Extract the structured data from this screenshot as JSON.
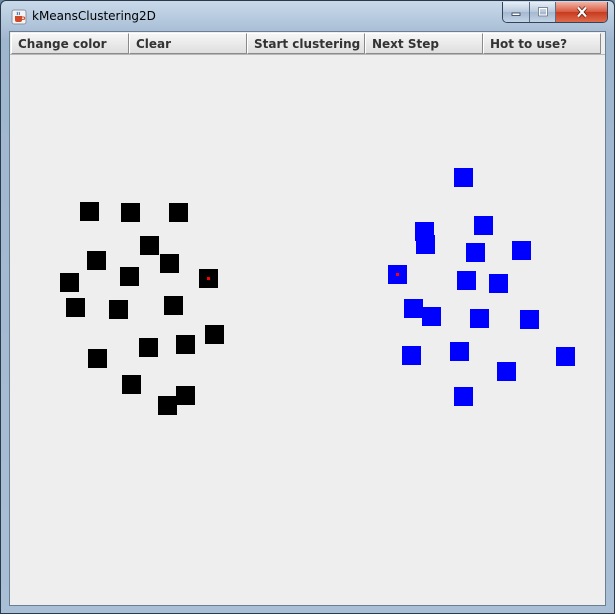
{
  "window": {
    "title": "kMeansClustering2D",
    "app_icon": "java-cup-icon",
    "controls": [
      "minimize-icon",
      "maximize-icon",
      "close-icon"
    ]
  },
  "toolbar": {
    "buttons": [
      {
        "label": "Change color"
      },
      {
        "label": "Clear"
      },
      {
        "label": "Start clustering"
      },
      {
        "label": "Next Step"
      },
      {
        "label": "Hot to use?"
      }
    ]
  },
  "canvas": {
    "background": "#eeeeee",
    "clusters": [
      {
        "color": "#000000",
        "points": [
          [
            79,
            201
          ],
          [
            120,
            202
          ],
          [
            168,
            202
          ],
          [
            139,
            235
          ],
          [
            86,
            250
          ],
          [
            159,
            253
          ],
          [
            59,
            272
          ],
          [
            119,
            266
          ],
          [
            198,
            268
          ],
          [
            65,
            297
          ],
          [
            108,
            299
          ],
          [
            163,
            295
          ],
          [
            204,
            324
          ],
          [
            138,
            337
          ],
          [
            175,
            334
          ],
          [
            87,
            348
          ],
          [
            121,
            374
          ],
          [
            175,
            385
          ],
          [
            157,
            395
          ]
        ],
        "centroid_index": 8
      },
      {
        "color": "#0000ff",
        "points": [
          [
            453,
            167
          ],
          [
            473,
            215
          ],
          [
            414,
            221
          ],
          [
            415,
            234
          ],
          [
            465,
            242
          ],
          [
            511,
            240
          ],
          [
            387,
            264
          ],
          [
            456,
            270
          ],
          [
            488,
            273
          ],
          [
            403,
            298
          ],
          [
            421,
            306
          ],
          [
            469,
            308
          ],
          [
            519,
            309
          ],
          [
            449,
            341
          ],
          [
            401,
            345
          ],
          [
            555,
            346
          ],
          [
            496,
            361
          ],
          [
            453,
            386
          ]
        ],
        "centroid_index": 6
      }
    ],
    "centroid_marker_color": "#ff0000"
  }
}
